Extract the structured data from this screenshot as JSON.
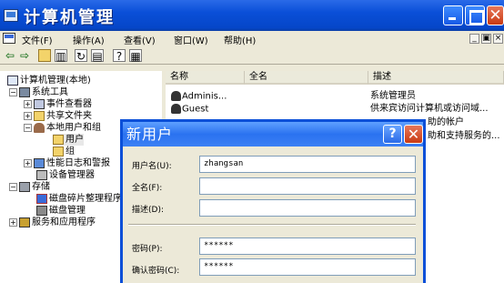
{
  "window": {
    "title": "计算机管理"
  },
  "menu": {
    "items": [
      "文件(F)",
      "操作(A)",
      "查看(V)",
      "窗口(W)",
      "帮助(H)"
    ],
    "mdi_min": "_",
    "mdi_restore": "▣",
    "mdi_close": "×"
  },
  "toolbar": {
    "icons": [
      "back-icon",
      "forward-icon",
      "up-folder-icon",
      "show-hide-tree-icon",
      "refresh-icon",
      "export-list-icon",
      "help-icon",
      "properties-icon"
    ]
  },
  "tree": {
    "items": [
      {
        "label": "计算机管理(本地)",
        "icon": "computer-icon",
        "expander": ""
      },
      {
        "label": "系统工具",
        "icon": "tools-icon",
        "expander": "−"
      },
      {
        "label": "事件查看器",
        "icon": "event-viewer-icon",
        "expander": "+"
      },
      {
        "label": "共享文件夹",
        "icon": "shared-folder-icon",
        "expander": "+"
      },
      {
        "label": "本地用户和组",
        "icon": "users-groups-icon",
        "expander": "−"
      },
      {
        "label": "用户",
        "icon": "folder-icon",
        "expander": ""
      },
      {
        "label": "组",
        "icon": "folder-icon",
        "expander": ""
      },
      {
        "label": "性能日志和警报",
        "icon": "performance-icon",
        "expander": "+"
      },
      {
        "label": "设备管理器",
        "icon": "device-manager-icon",
        "expander": ""
      },
      {
        "label": "存储",
        "icon": "storage-icon",
        "expander": "−"
      },
      {
        "label": "磁盘碎片整理程序",
        "icon": "defrag-icon",
        "expander": ""
      },
      {
        "label": "磁盘管理",
        "icon": "disk-management-icon",
        "expander": ""
      },
      {
        "label": "服务和应用程序",
        "icon": "services-icon",
        "expander": "+"
      }
    ]
  },
  "list": {
    "columns": [
      "名称",
      "全名",
      "描述"
    ],
    "rows": [
      {
        "name": "Adminis...",
        "fullname": "",
        "desc": "系统管理员"
      },
      {
        "name": "Guest",
        "fullname": "",
        "desc": "供来宾访问计算机或访问域..."
      },
      {
        "name": "",
        "fullname": "",
        "desc": "助的帐户"
      },
      {
        "name": "",
        "fullname": "",
        "desc": "助和支持服务的..."
      }
    ]
  },
  "dialog": {
    "title": "新用户",
    "help_label": "?",
    "close_label": "✕",
    "fields": [
      {
        "label": "用户名(U):",
        "value": "zhangsan"
      },
      {
        "label": "全名(F):",
        "value": ""
      },
      {
        "label": "描述(D):",
        "value": ""
      },
      {
        "label": "密码(P):",
        "value": "******"
      },
      {
        "label": "确认密码(C):",
        "value": "******"
      }
    ]
  },
  "colors": {
    "titlebar": "#0a4fd8",
    "dialog_title": "#2a72f0",
    "close_red": "#c93a12"
  }
}
